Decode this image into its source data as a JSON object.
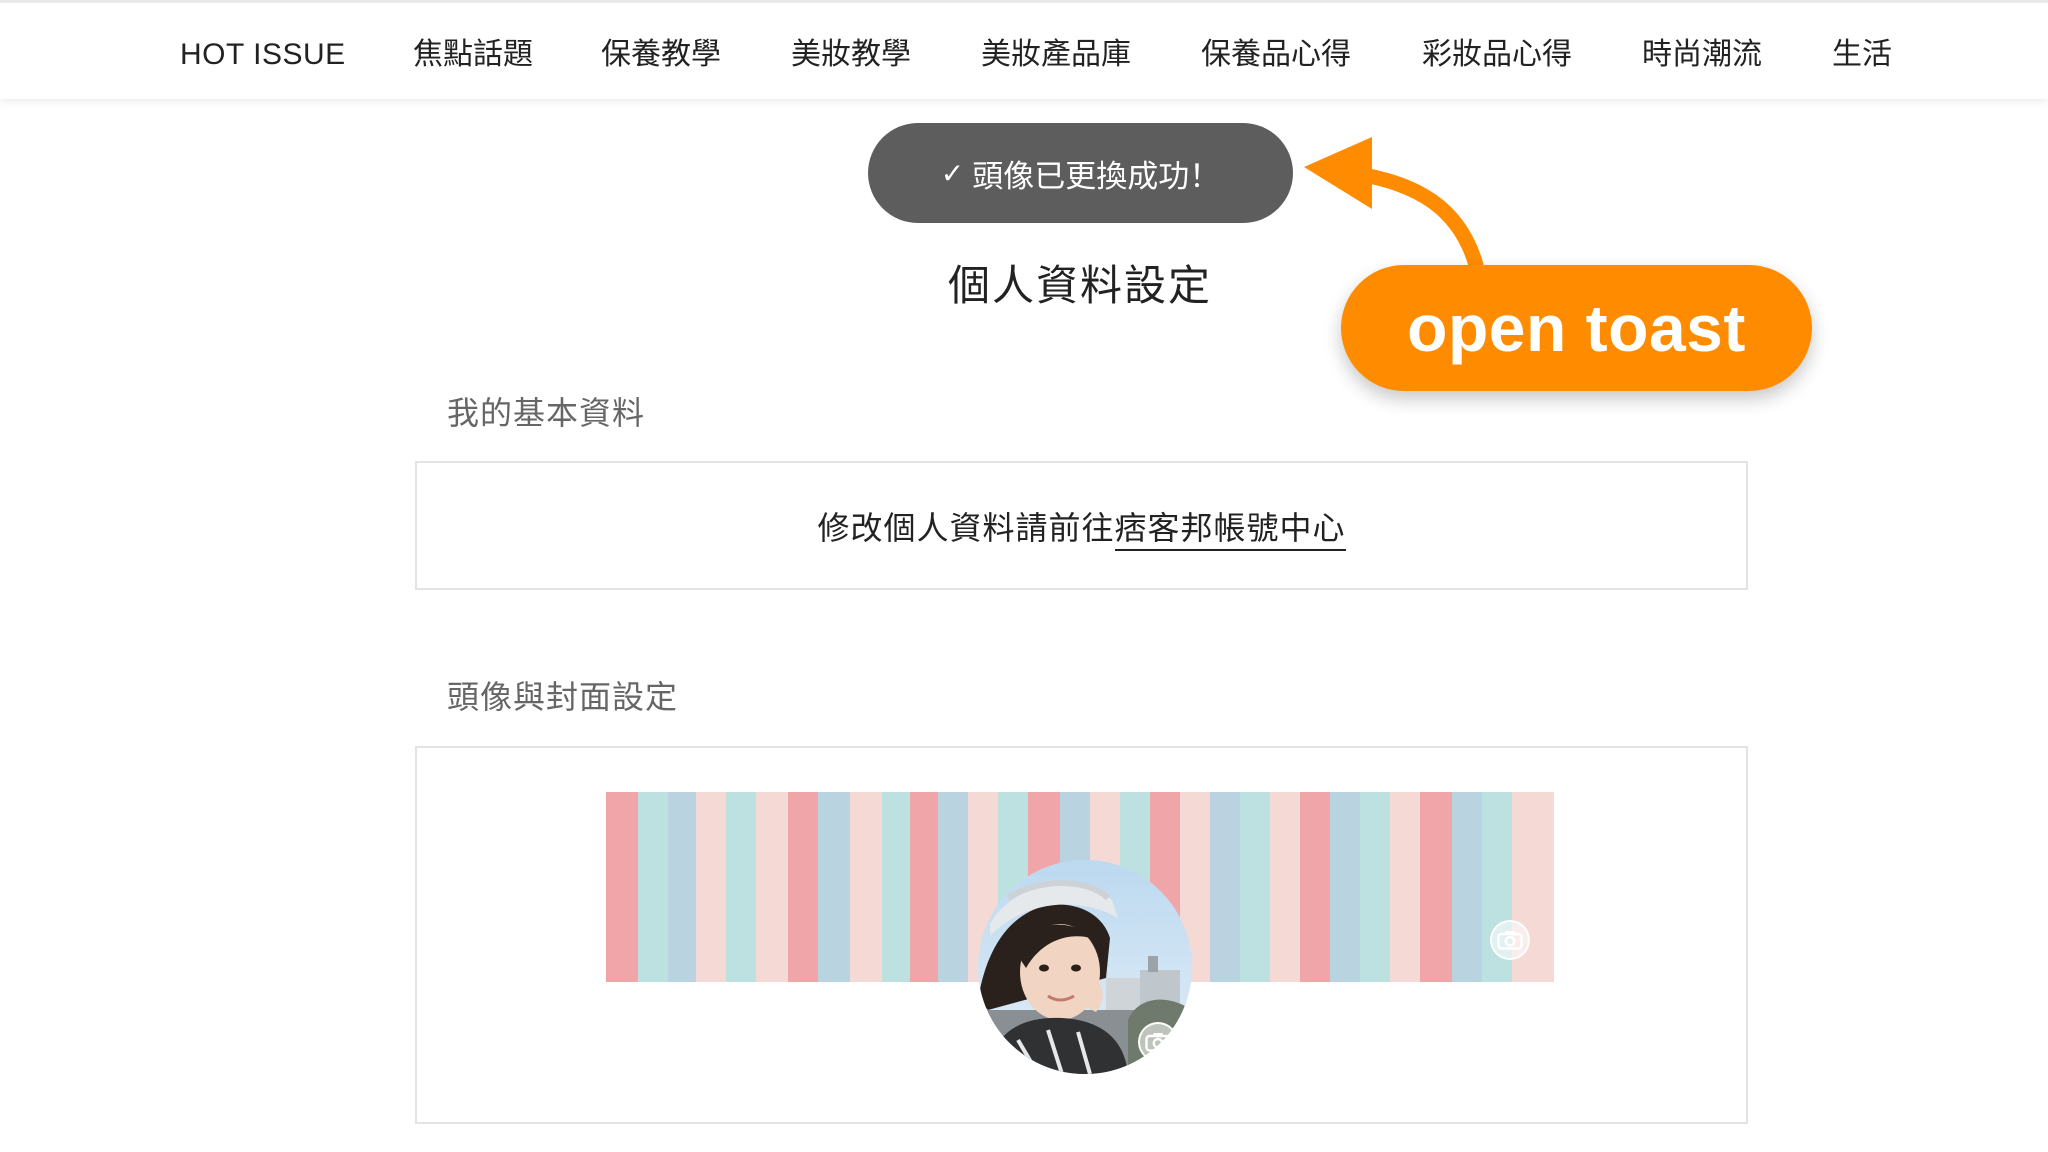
{
  "nav": {
    "items": [
      {
        "label": "HOT ISSUE"
      },
      {
        "label": "焦點話題"
      },
      {
        "label": "保養教學"
      },
      {
        "label": "美妝教學"
      },
      {
        "label": "美妝產品庫"
      },
      {
        "label": "保養品心得"
      },
      {
        "label": "彩妝品心得"
      },
      {
        "label": "時尚潮流"
      },
      {
        "label": "生活"
      }
    ]
  },
  "toast": {
    "check": "✓",
    "message": "頭像已更換成功！"
  },
  "annotation": {
    "label": "open toast",
    "color": "#ff8c00"
  },
  "page": {
    "title": "個人資料設定"
  },
  "basic_info": {
    "section_title": "我的基本資料",
    "text": "修改個人資料請前往",
    "link_label": "痞客邦帳號中心"
  },
  "avatar_cover": {
    "section_title": "頭像與封面設定",
    "cover_icon": "camera-icon",
    "avatar_icon": "camera-icon"
  },
  "colors": {
    "toast_bg": "#5d5d5d",
    "stripe_pink": "#ef9ea2",
    "stripe_teal": "#b8dede",
    "stripe_blue": "#b4d0df",
    "stripe_blush": "#f4d6d1"
  }
}
